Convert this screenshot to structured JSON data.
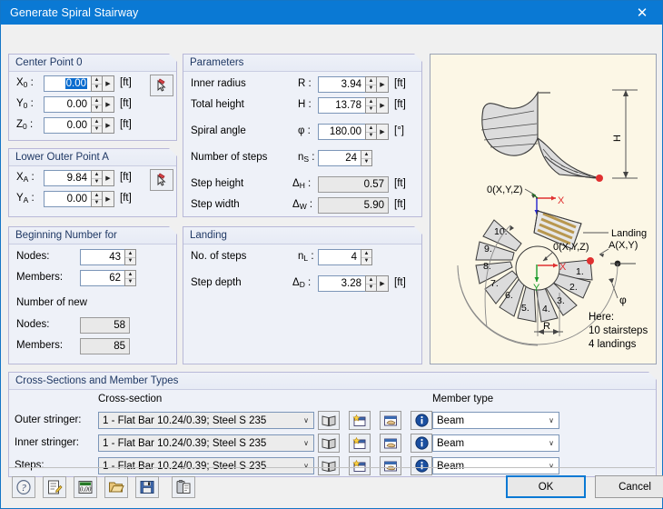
{
  "window": {
    "title": "Generate Spiral Stairway",
    "close_label": "✕",
    "accent_color": "#0a79d4",
    "group_title_color": "#1f3864"
  },
  "groups": {
    "center_point": {
      "title": "Center Point 0",
      "rows": [
        {
          "label": "X",
          "sub": "0",
          "value": "0.00",
          "unit": "[ft]",
          "selected": true
        },
        {
          "label": "Y",
          "sub": "0",
          "value": "0.00",
          "unit": "[ft]",
          "selected": false
        },
        {
          "label": "Z",
          "sub": "0",
          "value": "0.00",
          "unit": "[ft]",
          "selected": false
        }
      ],
      "pick_icon": "pick-cursor-icon"
    },
    "lower_outer_point": {
      "title": "Lower Outer Point A",
      "rows": [
        {
          "label": "X",
          "sub": "A",
          "value": "9.84",
          "unit": "[ft]"
        },
        {
          "label": "Y",
          "sub": "A",
          "value": "0.00",
          "unit": "[ft]"
        }
      ],
      "pick_icon": "pick-cursor-icon"
    },
    "beginning_number": {
      "title": "Beginning Number for",
      "rows": [
        {
          "label": "Nodes:",
          "value": "43"
        },
        {
          "label": "Members:",
          "value": "62"
        }
      ],
      "new_caption": "Number of new",
      "new_rows": [
        {
          "label": "Nodes:",
          "value": "58"
        },
        {
          "label": "Members:",
          "value": "85"
        }
      ]
    },
    "parameters": {
      "title": "Parameters",
      "rows": [
        {
          "label": "Inner radius",
          "sym": "R",
          "sub": "",
          "value": "3.94",
          "unit": "[ft]",
          "readonly": false,
          "more": true
        },
        {
          "label": "Total height",
          "sym": "H",
          "sub": "",
          "value": "13.78",
          "unit": "[ft]",
          "readonly": false,
          "more": true
        },
        {
          "label": "Spiral angle",
          "sym": "φ",
          "sub": "",
          "value": "180.00",
          "unit": "[°]",
          "readonly": false,
          "more": true
        },
        {
          "label": "Number of steps",
          "sym": "n",
          "sub": "S",
          "value": "24",
          "unit": "",
          "readonly": false,
          "more": false
        },
        {
          "label": "Step height",
          "sym": "Δ",
          "sub": "H",
          "value": "0.57",
          "unit": "[ft]",
          "readonly": true,
          "more": false
        },
        {
          "label": "Step width",
          "sym": "Δ",
          "sub": "W",
          "value": "5.90",
          "unit": "[ft]",
          "readonly": true,
          "more": false
        }
      ]
    },
    "landing": {
      "title": "Landing",
      "rows": [
        {
          "label": "No. of steps",
          "sym": "n",
          "sub": "L",
          "value": "4",
          "unit": "",
          "more": false
        },
        {
          "label": "Step depth",
          "sym": "Δ",
          "sub": "D",
          "value": "3.28",
          "unit": "[ft]",
          "more": true
        }
      ]
    },
    "cross_sections": {
      "title": "Cross-Sections and Member Types",
      "col_cross_section": "Cross-section",
      "col_member_type": "Member type",
      "rows": [
        {
          "label": "Outer stringer:",
          "cross_section": "1 - Flat Bar 10.24/0.39; Steel S 235",
          "member_type": "Beam"
        },
        {
          "label": "Inner stringer:",
          "cross_section": "1 - Flat Bar 10.24/0.39; Steel S 235",
          "member_type": "Beam"
        },
        {
          "label": "Steps:",
          "cross_section": "1 - Flat Bar 10.24/0.39; Steel S 235",
          "member_type": "Beam"
        }
      ],
      "row_icons": [
        "library-book-icon",
        "new-section-icon",
        "import-section-icon",
        "info-icon"
      ],
      "dropdown_arrow": "∨"
    }
  },
  "diagram": {
    "origin_label_top": "0(X,Y,Z)",
    "origin_label_plan": "0(X,Y,Z)",
    "point_a_label": "A(X,Y)",
    "height_label": "H",
    "radius_label": "R",
    "angle_label": "φ",
    "landing_label": "Landing",
    "axis_x": "X",
    "axis_y": "Y",
    "axis_z": "Z",
    "note_line1": "Here:",
    "note_line2": "10 stairsteps",
    "note_line3": "4 landings",
    "step_numbers": [
      "1.",
      "2.",
      "3.",
      "4.",
      "5.",
      "6.",
      "7.",
      "8.",
      "9.",
      "10."
    ],
    "background_color": "#fcf7e6"
  },
  "footer": {
    "tool_icons": [
      "help-icon",
      "edit-comment-icon",
      "units-icon",
      "open-folder-icon",
      "save-icon",
      "copy-icon"
    ],
    "ok_label": "OK",
    "cancel_label": "Cancel"
  }
}
